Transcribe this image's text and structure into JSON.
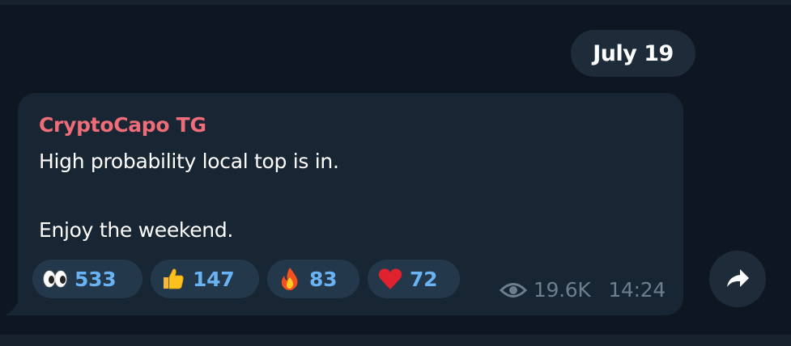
{
  "date_separator": "July 19",
  "message": {
    "sender": "CryptoCapo TG",
    "lines": [
      "High probability local top is in.",
      "Enjoy the weekend."
    ],
    "reactions": [
      {
        "emoji": "eyes-emoji",
        "count": "533"
      },
      {
        "emoji": "thumbs-up-emoji",
        "count": "147"
      },
      {
        "emoji": "fire-emoji",
        "count": "83"
      },
      {
        "emoji": "red-heart-emoji",
        "count": "72"
      }
    ],
    "views": "19.6K",
    "time": "14:24"
  },
  "colors": {
    "background": "#0e1621",
    "bubble": "#182533",
    "sender_name": "#ef6d78",
    "reaction_count": "#6ab3f3",
    "meta_text": "#6d7f8f"
  }
}
